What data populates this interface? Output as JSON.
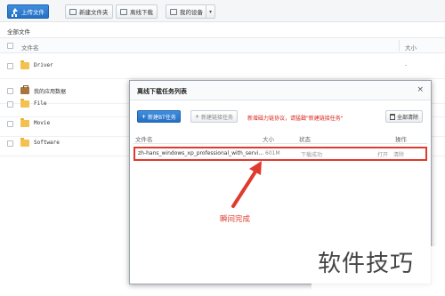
{
  "toolbar": {
    "upload_label": "上传文件",
    "new_folder_label": "新建文件夹",
    "offline_download_label": "离线下载",
    "my_devices_label": "我的设备"
  },
  "breadcrumb": "全部文件",
  "list": {
    "col_name": "文件名",
    "col_size": "大小",
    "rows": [
      {
        "name": "Driver",
        "size": "-",
        "icon": "folder-icon"
      },
      {
        "name": "我的应用数据",
        "size": "",
        "icon": "briefcase-icon"
      },
      {
        "name": "File",
        "size": "",
        "icon": "folder-icon"
      },
      {
        "name": "Movie",
        "size": "",
        "icon": "folder-icon"
      },
      {
        "name": "Software",
        "size": "",
        "icon": "folder-icon"
      }
    ]
  },
  "dialog": {
    "title": "离线下载任务列表",
    "close": "×",
    "new_bt_label": "新建BT任务",
    "new_link_label": "新建链接任务",
    "hint": "新增磁力链协议，请猛戳\"新建链接任务\"",
    "clear_all_label": "全部清除",
    "columns": {
      "name": "文件名",
      "size": "大小",
      "status": "状态",
      "action": "操作"
    },
    "task": {
      "name": "zh-hans_windows_xp_professional_with_servi...",
      "size": "601M",
      "status": "下载成功",
      "open": "打开",
      "clear": "清除"
    }
  },
  "annotation": "瞬间完成",
  "watermark": "软件技巧",
  "colors": {
    "accent": "#2a78c9",
    "highlight": "#e03a2e",
    "folder": "#f4c04f"
  }
}
